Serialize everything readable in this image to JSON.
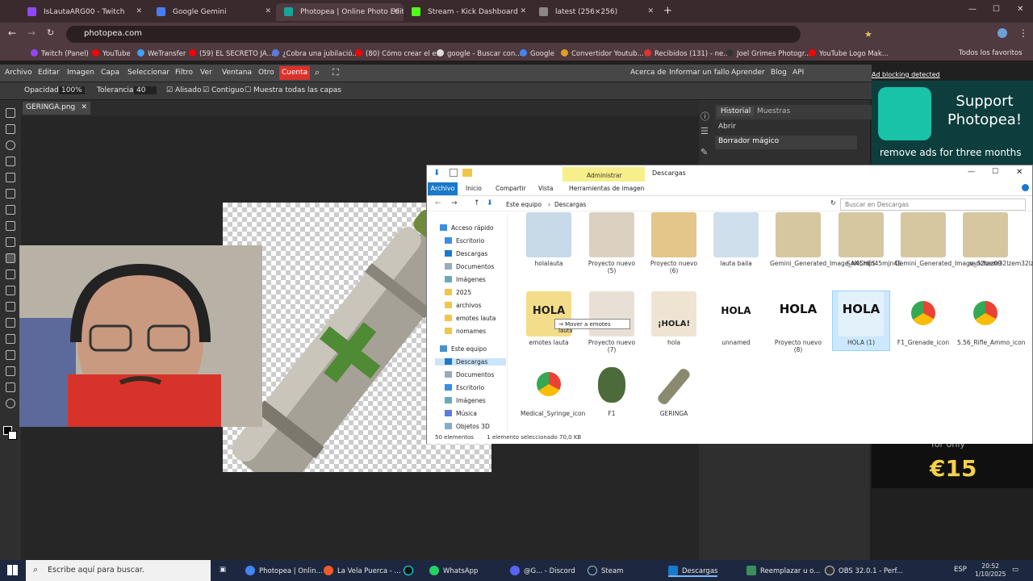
{
  "browser": {
    "tabs": [
      {
        "title": "IsLautaARG00 - Twitch",
        "color": "#9146ff"
      },
      {
        "title": "Google Gemini",
        "color": "#4a7cf0"
      },
      {
        "title": "Photopea | Online Photo Editor",
        "color": "#18a497",
        "active": true
      },
      {
        "title": "Stream - Kick Dashboard",
        "color": "#53fc18"
      },
      {
        "title": "latest (256×256)",
        "color": "#888888"
      }
    ],
    "url": "photopea.com",
    "bookmarks": [
      "Twitch (Panel)",
      "YouTube",
      "WeTransfer",
      "(59) EL SECRETO JA...",
      "¿Cobra una jubilació...",
      "(80) Cómo crear el e...",
      "google - Buscar con...",
      "Google",
      "Convertidor Youtub...",
      "Recibidos (131) - ne...",
      "Joel Grimes Photogr...",
      "YouTube Logo Mak..."
    ],
    "bookmarks_all": "Todos los favoritos"
  },
  "photopea": {
    "menu": [
      "Archivo",
      "Editar",
      "Imagen",
      "Capa",
      "Seleccionar",
      "Filtro",
      "Ver",
      "Ventana",
      "Otro"
    ],
    "account": "Cuenta",
    "right_menu": [
      "Acerca de",
      "Informar un fallo",
      "Aprender",
      "Blog",
      "API"
    ],
    "options": {
      "opacity_label": "Opacidad:",
      "opacity_value": "100%",
      "tolerance_label": "Tolerancia:",
      "tolerance_value": "40",
      "antialias": "Alisado",
      "contiguous": "Contiguo",
      "all_layers": "Muestra todas las capas"
    },
    "doc_tab": "GERINGA.png",
    "panel_tabs": [
      "Historial",
      "Muestras"
    ],
    "history": [
      "Abrir",
      "Borrador mágico"
    ],
    "ad_notice": "Ad blocking detected",
    "ad_title": "Support Photopea!",
    "ad_sub": "remove ads for three months",
    "ad_for_only": "for only",
    "ad_price": "€15"
  },
  "explorer": {
    "title": "Descargas",
    "ribbon_admin": "Administrar",
    "ribbon_tabs": [
      "Archivo",
      "Inicio",
      "Compartir",
      "Vista",
      "Herramientas de imagen"
    ],
    "path": [
      "Este equipo",
      "Descargas"
    ],
    "search_placeholder": "Buscar en Descargas",
    "sidebar": [
      {
        "label": "Acceso rápido",
        "level": 0
      },
      {
        "label": "Escritorio",
        "level": 1
      },
      {
        "label": "Descargas",
        "level": 1
      },
      {
        "label": "Documentos",
        "level": 1
      },
      {
        "label": "Imágenes",
        "level": 1
      },
      {
        "label": "2025",
        "level": 1
      },
      {
        "label": "archivos",
        "level": 1
      },
      {
        "label": "emotes lauta",
        "level": 1
      },
      {
        "label": "nomames",
        "level": 1
      },
      {
        "label": "Este equipo",
        "level": 0
      },
      {
        "label": "Descargas",
        "level": 1,
        "selected": true
      },
      {
        "label": "Documentos",
        "level": 1
      },
      {
        "label": "Escritorio",
        "level": 1
      },
      {
        "label": "Imágenes",
        "level": 1
      },
      {
        "label": "Música",
        "level": 1
      },
      {
        "label": "Objetos 3D",
        "level": 1
      }
    ],
    "files_row1": [
      {
        "name": "holalauta",
        "thumb": "#c8d9e8"
      },
      {
        "name": "Proyecto nuevo (5)",
        "thumb": "#dcd1c0"
      },
      {
        "name": "Proyecto nuevo (6)",
        "thumb": "#e4c58a"
      },
      {
        "name": "lauta baila",
        "thumb": "#cfe0ec"
      },
      {
        "name": "Gemini_Generated_Image_n45mjn45mjn45",
        "thumb": "#d6c7a1"
      },
      {
        "name": "SANCHES",
        "thumb": "#d6c7a1"
      },
      {
        "name": "Gemini_Generated_Image_32lzem32lzem32lz",
        "thumb": "#d6c7a1"
      },
      {
        "name": "sanchez09",
        "thumb": "#d6c7a1"
      }
    ],
    "files_row2": [
      {
        "name": "emotes lauta",
        "thumb": "#f4dd8a",
        "overlay": "HOLA"
      },
      {
        "name": "Proyecto nuevo (7)",
        "thumb": "#e9e0d5"
      },
      {
        "name": "hola",
        "thumb": "#efe4d2",
        "overlay": "¡HOLA!"
      },
      {
        "name": "unnamed",
        "thumb": "#ffffff",
        "overlay": "HOLA"
      },
      {
        "name": "Proyecto nuevo (8)",
        "thumb": "#ffffff",
        "overlay": "HOLA"
      },
      {
        "name": "HOLA (1)",
        "thumb": "#e3f1fb",
        "overlay": "HOLA",
        "selected": true
      },
      {
        "name": "F1_Grenade_icon",
        "thumb": "#ffffff"
      },
      {
        "name": "5.56_Rifle_Ammo_icon",
        "thumb": "#ffffff"
      }
    ],
    "files_row3": [
      {
        "name": "Medical_Syringe_icon",
        "thumb": "#ffffff"
      },
      {
        "name": "F1",
        "thumb": "#4c6a3a"
      },
      {
        "name": "GERINGA",
        "thumb": "#8a8a70"
      }
    ],
    "tooltip": "→ Mover a emotes lauta",
    "status_count": "50 elementos",
    "status_selected": "1 elemento seleccionado  70,0 KB"
  },
  "taskbar": {
    "search_placeholder": "Escribe aquí para buscar.",
    "apps": [
      "Photopea | Onlin...",
      "La Vela Puerca - ...",
      "WhatsApp",
      "@G... - Discord",
      "Steam",
      "Descargas",
      "Reemplazar u o...",
      "OBS 32.0.1 - Perf..."
    ],
    "lang": "ESP",
    "time": "20:52",
    "date": "1/10/2025"
  }
}
